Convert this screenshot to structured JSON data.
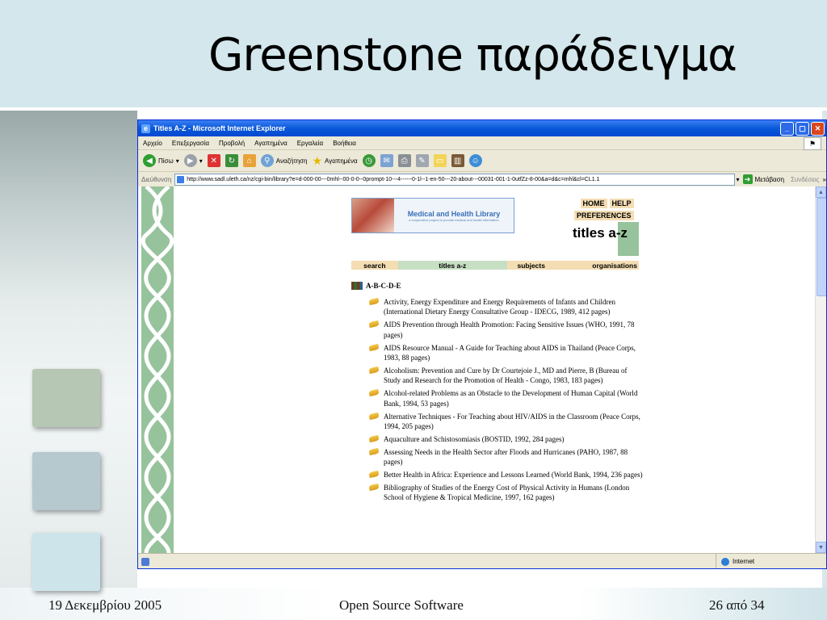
{
  "slide": {
    "title": "Greenstone παράδειγμα",
    "footer_left": "19 Δεκεμβρίου 2005",
    "footer_center": "Open Source Software",
    "footer_right": "26 από 34"
  },
  "browser": {
    "window_title": "Titles A-Z - Microsoft Internet Explorer",
    "menu": [
      "Αρχείο",
      "Επεξεργασία",
      "Προβολή",
      "Αγαπημένα",
      "Εργαλεία",
      "Βοήθεια"
    ],
    "toolbar": {
      "back": "Πίσω",
      "search": "Αναζήτηση",
      "favorites": "Αγαπημένα"
    },
    "address_label": "Διεύθυνση",
    "url": "http://www.sadl.uleth.ca/nz/cgi-bin/library?e=d-000-00---0mhl--00-0-0--0prompt-10---4------0-1l--1-en-50---20-about---00031-001-1-0utfZz-8-00&a=d&c=mhl&cl=CL1.1",
    "go_label": "Μετάβαση",
    "links_label": "Συνδέσεις",
    "status_zone": "Internet"
  },
  "library": {
    "banner_title": "Medical and Health Library",
    "banner_subtitle": "a cooperative project to provide medical and health information",
    "nav_home": "HOME",
    "nav_help": "HELP",
    "nav_prefs": "PREFERENCES",
    "heading": "titles a-z",
    "tabs": [
      "search",
      "titles a-z",
      "subjects",
      "organisations"
    ],
    "letter_range": "A-B-C-D-E",
    "titles": [
      "Activity, Energy Expenditure and Energy Requirements of Infants and Children (International Dietary Energy Consultative Group - IDECG, 1989, 412 pages)",
      "AIDS Prevention through Health Promotion: Facing Sensitive Issues (WHO, 1991, 78 pages)",
      "AIDS Resource Manual - A Guide for Teaching about AIDS in Thailand (Peace Corps, 1983, 88 pages)",
      "Alcoholism: Prevention and Cure by Dr Courtejoie J., MD and Pierre, B (Bureau of Study and Research for the Promotion of Health - Congo, 1983, 183 pages)",
      "Alcohol-related Problems as an Obstacle to the Development of Human Capital (World Bank, 1994, 53 pages)",
      "Alternative Techniques - For Teaching about HIV/AIDS in the Classroom (Peace Corps, 1994, 205 pages)",
      "Aquaculture and Schistosomiasis (BOSTID, 1992, 284 pages)",
      "Assessing Needs in the Health Sector after Floods and Hurricanes (PAHO, 1987, 88 pages)",
      "Better Health in Africa: Experience and Lessons Learned (World Bank, 1994, 236 pages)",
      "Bibliography of Studies of the Energy Cost of Physical Activity in Humans (London School of Hygiene & Tropical Medicine, 1997, 162 pages)"
    ]
  },
  "colors": {
    "slide_header": "#d3e7ec",
    "greenstone_green": "#97c39c",
    "greenstone_tan": "#f4ddb3",
    "xp_blue": "#0a58d8"
  }
}
